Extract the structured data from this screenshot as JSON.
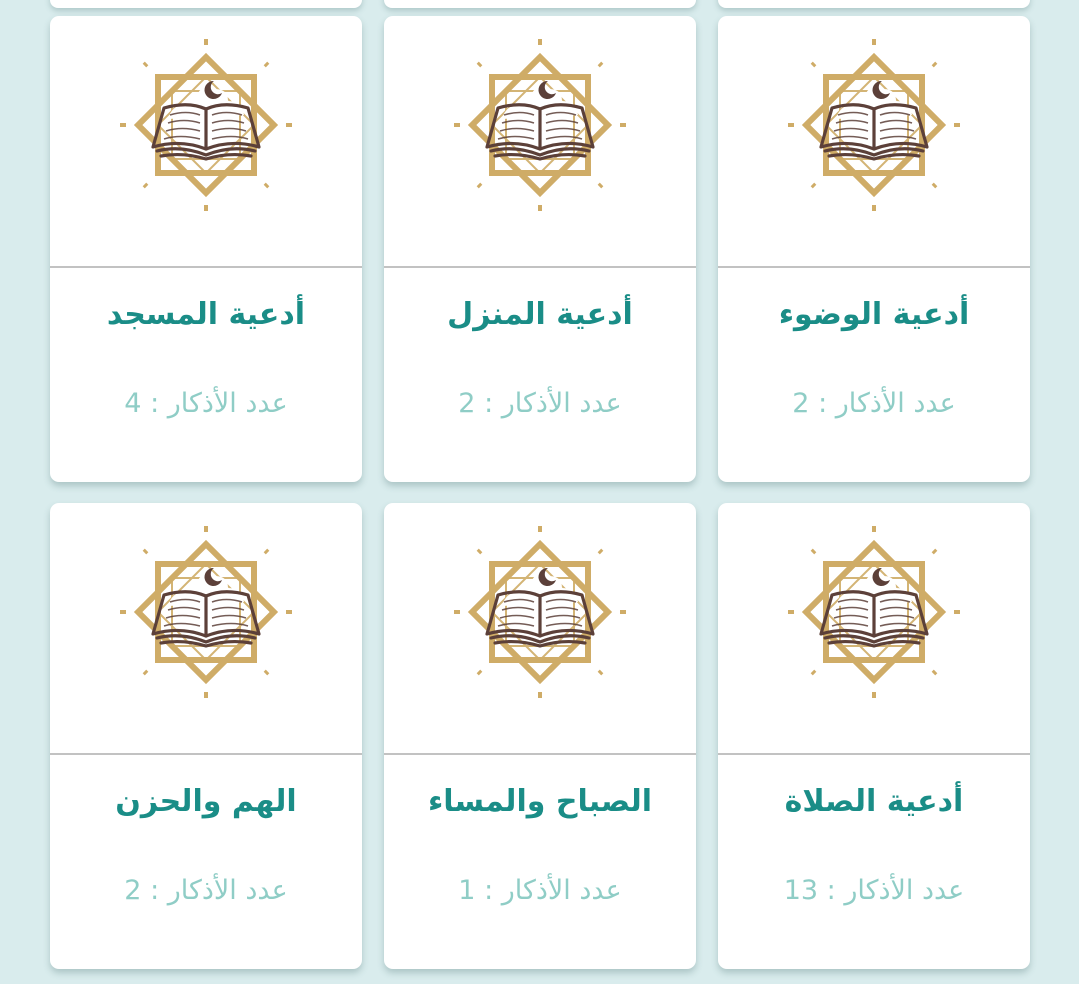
{
  "colors": {
    "background": "#d9eced",
    "card": "#ffffff",
    "title": "#1a8d87",
    "count": "#8fcdc6",
    "emblem_gold": "#cfac67",
    "book_brown": "#5c4039"
  },
  "cards": [
    {
      "title": "أدعية الوضوء",
      "count_text": "عدد الأذكار : 2",
      "icon": "quran-book-emblem-icon"
    },
    {
      "title": "أدعية المنزل",
      "count_text": "عدد الأذكار : 2",
      "icon": "quran-book-emblem-icon"
    },
    {
      "title": "أدعية المسجد",
      "count_text": "عدد الأذكار : 4",
      "icon": "quran-book-emblem-icon"
    },
    {
      "title": "أدعية الصلاة",
      "count_text": "عدد الأذكار : 13",
      "icon": "quran-book-emblem-icon"
    },
    {
      "title": "الصباح والمساء",
      "count_text": "عدد الأذكار : 1",
      "icon": "quran-book-emblem-icon"
    },
    {
      "title": "الهم والحزن",
      "count_text": "عدد الأذكار : 2",
      "icon": "quran-book-emblem-icon"
    }
  ]
}
